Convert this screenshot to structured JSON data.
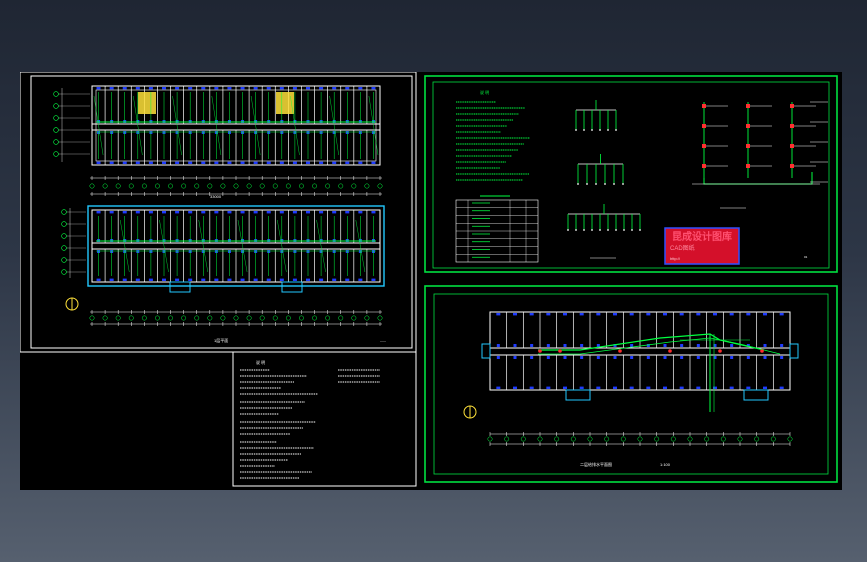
{
  "drawing_1": {
    "dimension": "33000",
    "plan_title": "1层平面"
  },
  "notes_sheet": {
    "heading": "说 明"
  },
  "system_sheet": {
    "heading": "说 明",
    "stamp_line1": "昆成设计图库",
    "stamp_line2": "CAD图纸",
    "stamp_line3": "http://",
    "sheet_no": "01"
  },
  "plan_sheet": {
    "title": "二层给排水平面图",
    "scale": "1:100"
  },
  "colors": {
    "background": "#000000",
    "walls": "#ffffff",
    "pipes": "#00ff40",
    "fixtures": "#1f3cff",
    "stairs": "#ffe23a",
    "stamp": "#e0102a",
    "frame": "#00e040"
  }
}
